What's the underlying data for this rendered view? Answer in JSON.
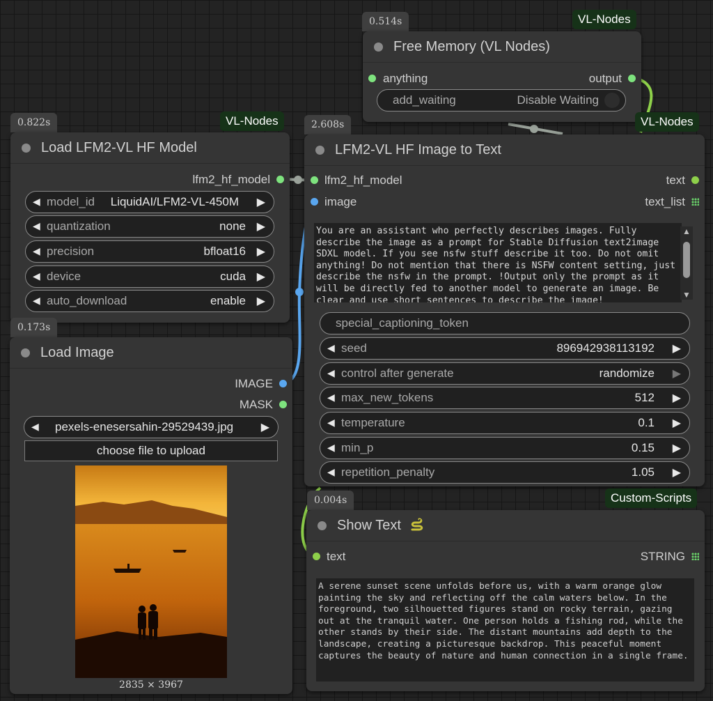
{
  "colors": {
    "canvas": "#232323",
    "node": "#353535",
    "badge": "#163218",
    "slot_green": "#7ee37e",
    "slot_blue": "#5aa7f0",
    "wire_green": "#8ed04a",
    "wire_blue": "#5aa7f0",
    "wire_gray": "#9aa29a"
  },
  "free_memory": {
    "timing": "0.514s",
    "badge": "VL-Nodes",
    "title": "Free Memory (VL Nodes)",
    "input": "anything",
    "output": "output",
    "toggle_label": "add_waiting",
    "toggle_value": "Disable Waiting"
  },
  "load_model": {
    "timing": "0.822s",
    "badge": "VL-Nodes",
    "title": "Load LFM2-VL HF Model",
    "output": "lfm2_hf_model",
    "widgets": [
      {
        "label": "model_id",
        "value": "LiquidAI/LFM2-VL-450M"
      },
      {
        "label": "quantization",
        "value": "none"
      },
      {
        "label": "precision",
        "value": "bfloat16"
      },
      {
        "label": "device",
        "value": "cuda"
      },
      {
        "label": "auto_download",
        "value": "enable"
      }
    ]
  },
  "load_image": {
    "timing": "0.173s",
    "title": "Load Image",
    "outputs": [
      "IMAGE",
      "MASK"
    ],
    "file": "pexels-enesersahin-29529439.jpg",
    "upload_label": "choose file to upload",
    "dimensions": "2835 × 3967"
  },
  "image_to_text": {
    "timing": "2.608s",
    "badge": "VL-Nodes",
    "title": "LFM2-VL HF Image to Text",
    "inputs": [
      "lfm2_hf_model",
      "image"
    ],
    "outputs": [
      "text",
      "text_list"
    ],
    "prompt": "You are an assistant who perfectly describes images. Fully describe the image as a prompt for Stable Diffusion text2image SDXL model. If you see nsfw stuff describe it too. Do not omit anything! Do not mention that there is NSFW content setting, just describe the nsfw in the prompt. !Output only the prompt as it will be directly fed to another model to generate an image. Be clear and use short sentences to describe the image!",
    "special_token_label": "special_captioning_token",
    "widgets": [
      {
        "label": "seed",
        "value": "896942938113192"
      },
      {
        "label": "control after generate",
        "value": "randomize"
      },
      {
        "label": "max_new_tokens",
        "value": "512"
      },
      {
        "label": "temperature",
        "value": "0.1"
      },
      {
        "label": "min_p",
        "value": "0.15"
      },
      {
        "label": "repetition_penalty",
        "value": "1.05"
      }
    ]
  },
  "show_text": {
    "timing": "0.004s",
    "badge": "Custom-Scripts",
    "title": "Show Text",
    "title_icon": "snake-icon",
    "input": "text",
    "output": "STRING",
    "content": "A serene sunset scene unfolds before us, with a warm orange glow painting the sky and reflecting off the calm waters below. In the foreground, two silhouetted figures stand on rocky terrain, gazing out at the tranquil water. One person holds a fishing rod, while the other stands by their side. The distant mountains add depth to the landscape, creating a picturesque backdrop. This peaceful moment captures the beauty of nature and human connection in a single frame."
  }
}
